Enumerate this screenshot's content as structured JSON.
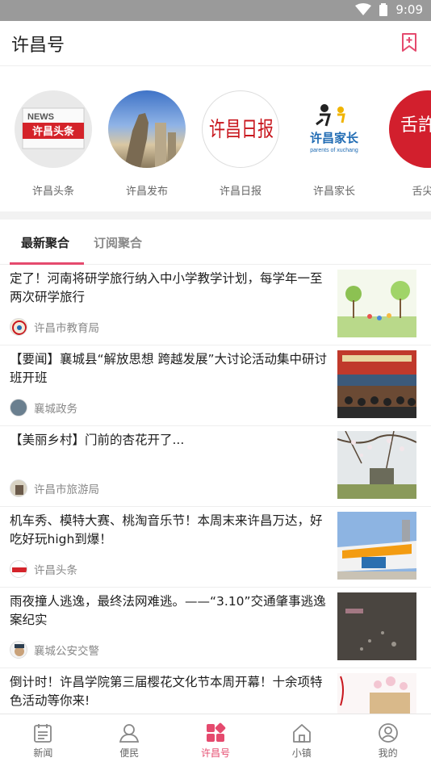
{
  "status_bar": {
    "time": "9:09",
    "icons": [
      "wifi-icon",
      "battery-icon"
    ]
  },
  "header": {
    "title": "许昌号",
    "action_icon": "bookmark-add-icon"
  },
  "channels": [
    {
      "label": "许昌头条",
      "logo_text": "NEWS",
      "logo_sub": "许昌头条"
    },
    {
      "label": "许昌发布"
    },
    {
      "label": "许昌日报",
      "logo_text": "许昌日报"
    },
    {
      "label": "许昌家长",
      "logo_text": "许昌家长",
      "logo_sub": "parents of xuchang"
    },
    {
      "label": "舌尖许",
      "logo_text": "舌許"
    }
  ],
  "tabs": [
    {
      "label": "最新聚合",
      "active": true
    },
    {
      "label": "订阅聚合",
      "active": false
    }
  ],
  "news": [
    {
      "title": "定了！河南将研学旅行纳入中小学教学计划，每学年一至两次研学旅行",
      "source": "许昌市教育局"
    },
    {
      "title": "【要闻】襄城县“解放思想 跨越发展”大讨论活动集中研讨班开班",
      "source": "襄城政务"
    },
    {
      "title": "【美丽乡村】门前的杏花开了...",
      "source": "许昌市旅游局"
    },
    {
      "title": "机车秀、模特大赛、桃淘音乐节！本周末来许昌万达，好吃好玩high到爆！",
      "source": "许昌头条"
    },
    {
      "title": "雨夜撞人逃逸，最终法网难逃。——“3.10”交通肇事逃逸案纪实",
      "source": "襄城公安交警"
    },
    {
      "title": "倒计时！许昌学院第三届樱花文化节本周开幕！十余项特色活动等你来!",
      "source": ""
    }
  ],
  "bottom_nav": [
    {
      "label": "新闻",
      "icon": "calendar-icon",
      "active": false
    },
    {
      "label": "便民",
      "icon": "people-icon",
      "active": false
    },
    {
      "label": "许昌号",
      "icon": "grid-icon",
      "active": true
    },
    {
      "label": "小镇",
      "icon": "home-icon",
      "active": false
    },
    {
      "label": "我的",
      "icon": "user-icon",
      "active": false
    }
  ],
  "colors": {
    "accent": "#e54a6e",
    "status_bar": "#9a9a9a"
  }
}
